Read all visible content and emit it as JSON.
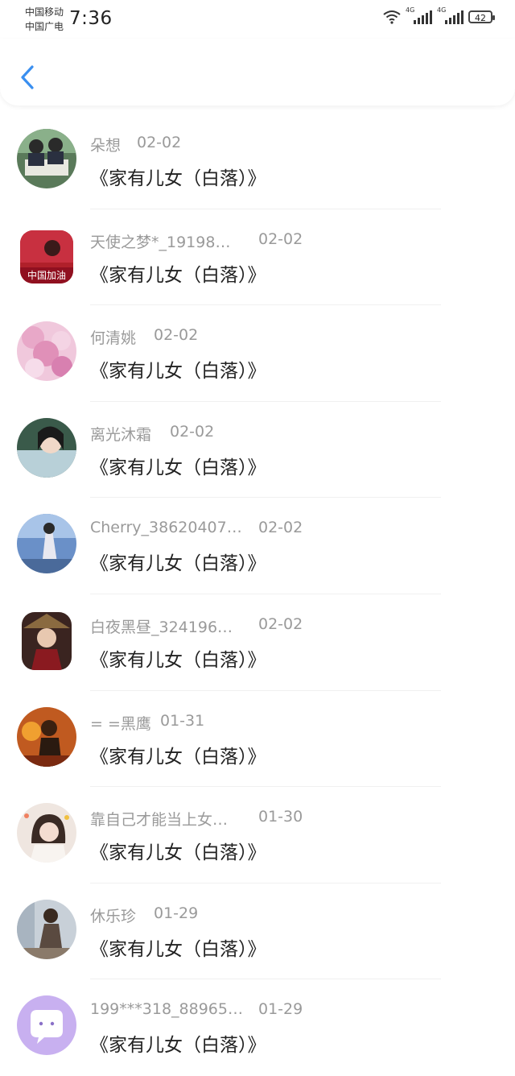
{
  "status_bar": {
    "carrier_1": "中国移动",
    "carrier_2": "中国广电",
    "time": "7:36",
    "network_1": "4G",
    "network_2": "4G",
    "battery": "42"
  },
  "header": {
    "back_icon": "chevron-left-icon",
    "accent": "#3a8ff0"
  },
  "comments": [
    {
      "name": "朵想",
      "date": "02-02",
      "text": "《家有儿女（白落）》",
      "avatar_color": "#5a7a5a"
    },
    {
      "name": "天使之梦*_19198…",
      "date": "02-02",
      "text": "《家有儿女（白落）》",
      "avatar_color": "#b0202a"
    },
    {
      "name": "何清姚",
      "date": "02-02",
      "text": "《家有儿女（白落）》",
      "avatar_color": "#e8a8c8"
    },
    {
      "name": "离光沐霜",
      "date": "02-02",
      "text": "《家有儿女（白落）》",
      "avatar_color": "#3a5a4a"
    },
    {
      "name": "Cherry_38620407…",
      "date": "02-02",
      "text": "《家有儿女（白落）》",
      "avatar_color": "#6a90c8"
    },
    {
      "name": "白夜黑昼_324196…",
      "date": "02-02",
      "text": "《家有儿女（白落）》",
      "avatar_color": "#5a3a30"
    },
    {
      "name": "= =黑鹰",
      "date": "01-31",
      "text": "《家有儿女（白落）》",
      "avatar_color": "#c05a20"
    },
    {
      "name": "靠自己才能当上女…",
      "date": "01-30",
      "text": "《家有儿女（白落）》",
      "avatar_color": "#d8c0b8"
    },
    {
      "name": "休乐珍",
      "date": "01-29",
      "text": "《家有儿女（白落）》",
      "avatar_color": "#8a9aa8"
    },
    {
      "name": "199***318_88965…",
      "date": "01-29",
      "text": "《家有儿女（白落）》",
      "avatar_color": "#c8b0f0"
    }
  ]
}
